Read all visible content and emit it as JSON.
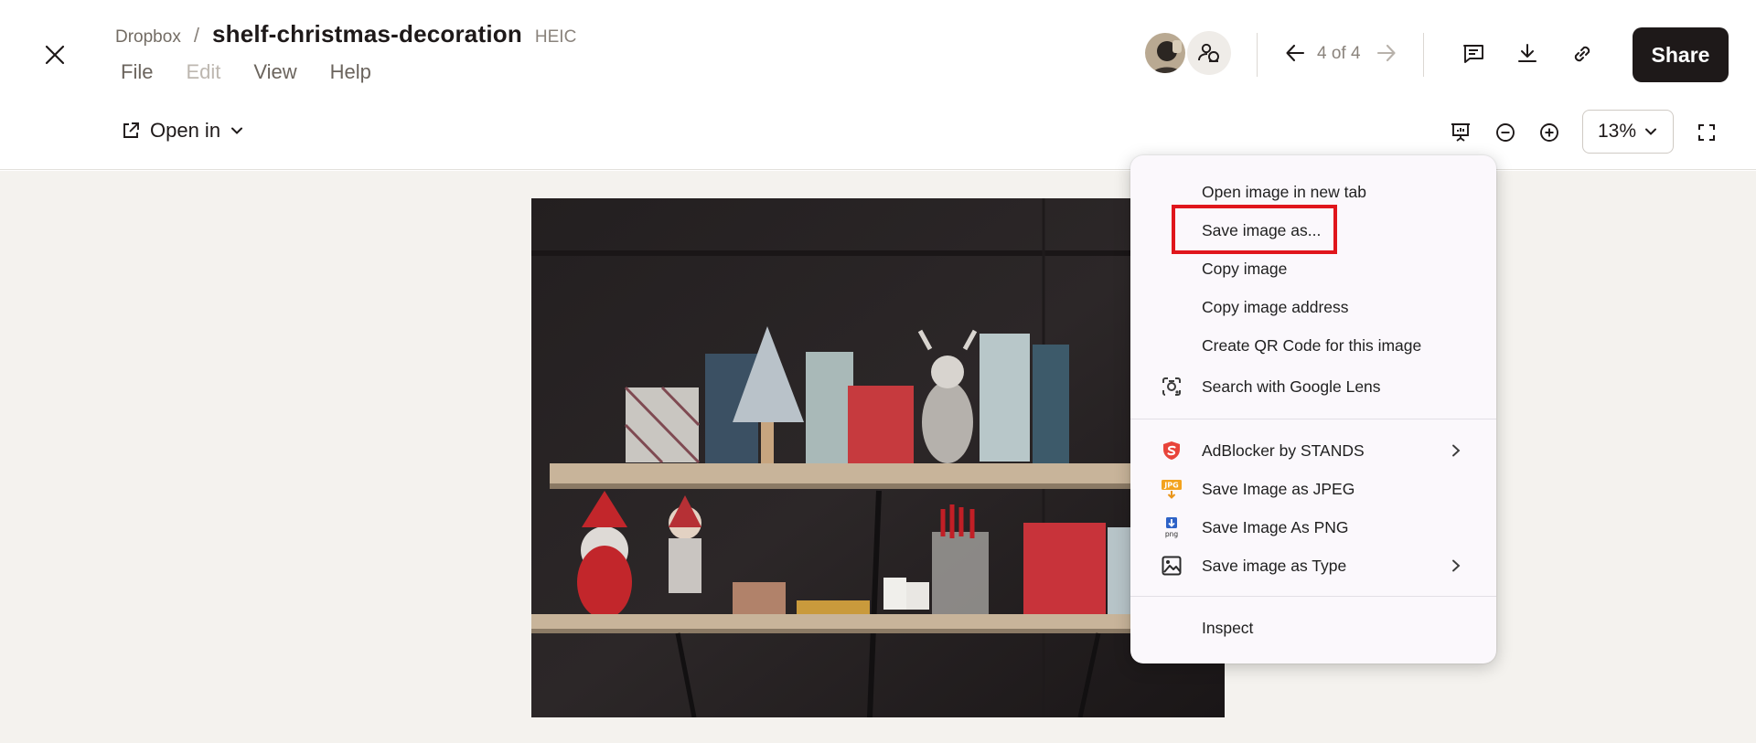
{
  "header": {
    "breadcrumb_root": "Dropbox",
    "breadcrumb_sep": "/",
    "file_name": "shelf-christmas-decoration",
    "file_ext": "HEIC",
    "menu": {
      "file": "File",
      "edit": "Edit",
      "view": "View",
      "help": "Help"
    },
    "nav_count": "4 of 4",
    "share_label": "Share",
    "open_in_label": "Open in",
    "zoom_value": "13%"
  },
  "context_menu": {
    "items": [
      {
        "label": "Open image in new tab"
      },
      {
        "label": "Save image as..."
      },
      {
        "label": "Copy image"
      },
      {
        "label": "Copy image address"
      },
      {
        "label": "Create QR Code for this image"
      },
      {
        "label": "Search with Google Lens",
        "icon": "google-lens-icon"
      },
      {
        "label": "AdBlocker by STANDS",
        "icon": "adblocker-stands-icon",
        "submenu": true
      },
      {
        "label": "Save Image as JPEG",
        "icon": "jpg-icon"
      },
      {
        "label": "Save Image As PNG",
        "icon": "png-icon"
      },
      {
        "label": "Save image as Type",
        "icon": "image-icon",
        "submenu": true
      },
      {
        "label": "Inspect"
      }
    ],
    "highlighted_item": "Save image as..."
  },
  "icon_labels": {
    "jpg_badge": "JPG",
    "png_badge": "png"
  },
  "colors": {
    "accent_dark": "#1e1919",
    "canvas_bg": "#f4f2ee",
    "highlight_red": "#e0161c",
    "stands_red": "#e8443a"
  }
}
